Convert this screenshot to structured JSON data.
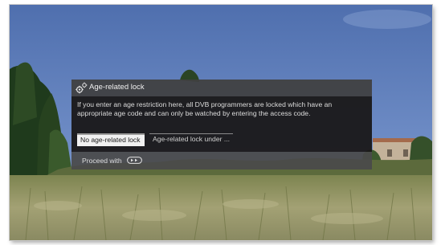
{
  "dialog": {
    "title": "Age-related lock",
    "icon": "gears-icon",
    "message": "If you enter an age restriction here, all DVB programmers are locked which have an appropriate age code and can only be watched by entering the access code.",
    "options": [
      {
        "label": "No age-related lock",
        "selected": true
      },
      {
        "label": "Age-related lock under ...",
        "selected": false
      }
    ],
    "footer": {
      "proceed_label": "Proceed with",
      "key_icon": "ok-remote-key-icon"
    }
  },
  "colors": {
    "sky": "#5a79b6",
    "header_bg": "#404040",
    "body_bg": "#191717",
    "footer_bg": "#4a4a4a",
    "selected_bg": "#f1f1f1"
  }
}
